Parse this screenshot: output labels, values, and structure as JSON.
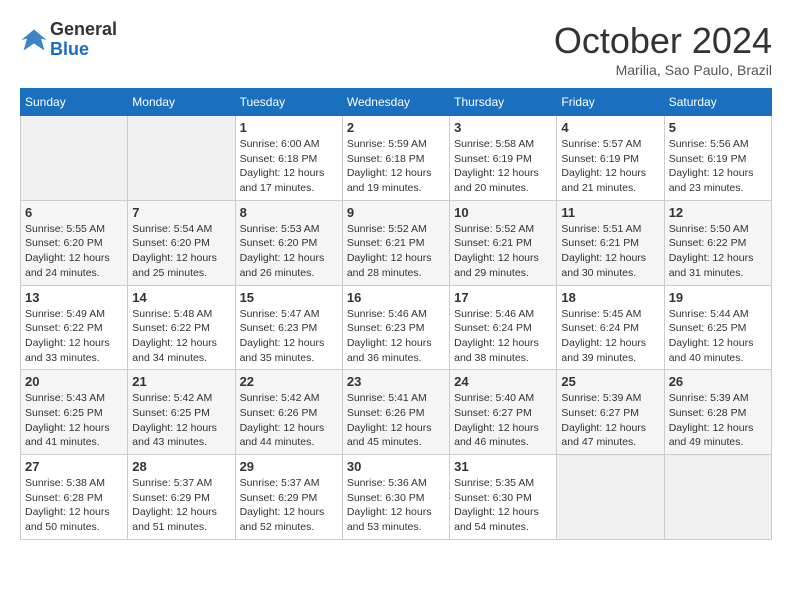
{
  "header": {
    "logo_general": "General",
    "logo_blue": "Blue",
    "month_title": "October 2024",
    "location": "Marilia, Sao Paulo, Brazil"
  },
  "weekdays": [
    "Sunday",
    "Monday",
    "Tuesday",
    "Wednesday",
    "Thursday",
    "Friday",
    "Saturday"
  ],
  "weeks": [
    [
      {
        "day": "",
        "info": ""
      },
      {
        "day": "",
        "info": ""
      },
      {
        "day": "1",
        "info": "Sunrise: 6:00 AM\nSunset: 6:18 PM\nDaylight: 12 hours and 17 minutes."
      },
      {
        "day": "2",
        "info": "Sunrise: 5:59 AM\nSunset: 6:18 PM\nDaylight: 12 hours and 19 minutes."
      },
      {
        "day": "3",
        "info": "Sunrise: 5:58 AM\nSunset: 6:19 PM\nDaylight: 12 hours and 20 minutes."
      },
      {
        "day": "4",
        "info": "Sunrise: 5:57 AM\nSunset: 6:19 PM\nDaylight: 12 hours and 21 minutes."
      },
      {
        "day": "5",
        "info": "Sunrise: 5:56 AM\nSunset: 6:19 PM\nDaylight: 12 hours and 23 minutes."
      }
    ],
    [
      {
        "day": "6",
        "info": "Sunrise: 5:55 AM\nSunset: 6:20 PM\nDaylight: 12 hours and 24 minutes."
      },
      {
        "day": "7",
        "info": "Sunrise: 5:54 AM\nSunset: 6:20 PM\nDaylight: 12 hours and 25 minutes."
      },
      {
        "day": "8",
        "info": "Sunrise: 5:53 AM\nSunset: 6:20 PM\nDaylight: 12 hours and 26 minutes."
      },
      {
        "day": "9",
        "info": "Sunrise: 5:52 AM\nSunset: 6:21 PM\nDaylight: 12 hours and 28 minutes."
      },
      {
        "day": "10",
        "info": "Sunrise: 5:52 AM\nSunset: 6:21 PM\nDaylight: 12 hours and 29 minutes."
      },
      {
        "day": "11",
        "info": "Sunrise: 5:51 AM\nSunset: 6:21 PM\nDaylight: 12 hours and 30 minutes."
      },
      {
        "day": "12",
        "info": "Sunrise: 5:50 AM\nSunset: 6:22 PM\nDaylight: 12 hours and 31 minutes."
      }
    ],
    [
      {
        "day": "13",
        "info": "Sunrise: 5:49 AM\nSunset: 6:22 PM\nDaylight: 12 hours and 33 minutes."
      },
      {
        "day": "14",
        "info": "Sunrise: 5:48 AM\nSunset: 6:22 PM\nDaylight: 12 hours and 34 minutes."
      },
      {
        "day": "15",
        "info": "Sunrise: 5:47 AM\nSunset: 6:23 PM\nDaylight: 12 hours and 35 minutes."
      },
      {
        "day": "16",
        "info": "Sunrise: 5:46 AM\nSunset: 6:23 PM\nDaylight: 12 hours and 36 minutes."
      },
      {
        "day": "17",
        "info": "Sunrise: 5:46 AM\nSunset: 6:24 PM\nDaylight: 12 hours and 38 minutes."
      },
      {
        "day": "18",
        "info": "Sunrise: 5:45 AM\nSunset: 6:24 PM\nDaylight: 12 hours and 39 minutes."
      },
      {
        "day": "19",
        "info": "Sunrise: 5:44 AM\nSunset: 6:25 PM\nDaylight: 12 hours and 40 minutes."
      }
    ],
    [
      {
        "day": "20",
        "info": "Sunrise: 5:43 AM\nSunset: 6:25 PM\nDaylight: 12 hours and 41 minutes."
      },
      {
        "day": "21",
        "info": "Sunrise: 5:42 AM\nSunset: 6:25 PM\nDaylight: 12 hours and 43 minutes."
      },
      {
        "day": "22",
        "info": "Sunrise: 5:42 AM\nSunset: 6:26 PM\nDaylight: 12 hours and 44 minutes."
      },
      {
        "day": "23",
        "info": "Sunrise: 5:41 AM\nSunset: 6:26 PM\nDaylight: 12 hours and 45 minutes."
      },
      {
        "day": "24",
        "info": "Sunrise: 5:40 AM\nSunset: 6:27 PM\nDaylight: 12 hours and 46 minutes."
      },
      {
        "day": "25",
        "info": "Sunrise: 5:39 AM\nSunset: 6:27 PM\nDaylight: 12 hours and 47 minutes."
      },
      {
        "day": "26",
        "info": "Sunrise: 5:39 AM\nSunset: 6:28 PM\nDaylight: 12 hours and 49 minutes."
      }
    ],
    [
      {
        "day": "27",
        "info": "Sunrise: 5:38 AM\nSunset: 6:28 PM\nDaylight: 12 hours and 50 minutes."
      },
      {
        "day": "28",
        "info": "Sunrise: 5:37 AM\nSunset: 6:29 PM\nDaylight: 12 hours and 51 minutes."
      },
      {
        "day": "29",
        "info": "Sunrise: 5:37 AM\nSunset: 6:29 PM\nDaylight: 12 hours and 52 minutes."
      },
      {
        "day": "30",
        "info": "Sunrise: 5:36 AM\nSunset: 6:30 PM\nDaylight: 12 hours and 53 minutes."
      },
      {
        "day": "31",
        "info": "Sunrise: 5:35 AM\nSunset: 6:30 PM\nDaylight: 12 hours and 54 minutes."
      },
      {
        "day": "",
        "info": ""
      },
      {
        "day": "",
        "info": ""
      }
    ]
  ]
}
